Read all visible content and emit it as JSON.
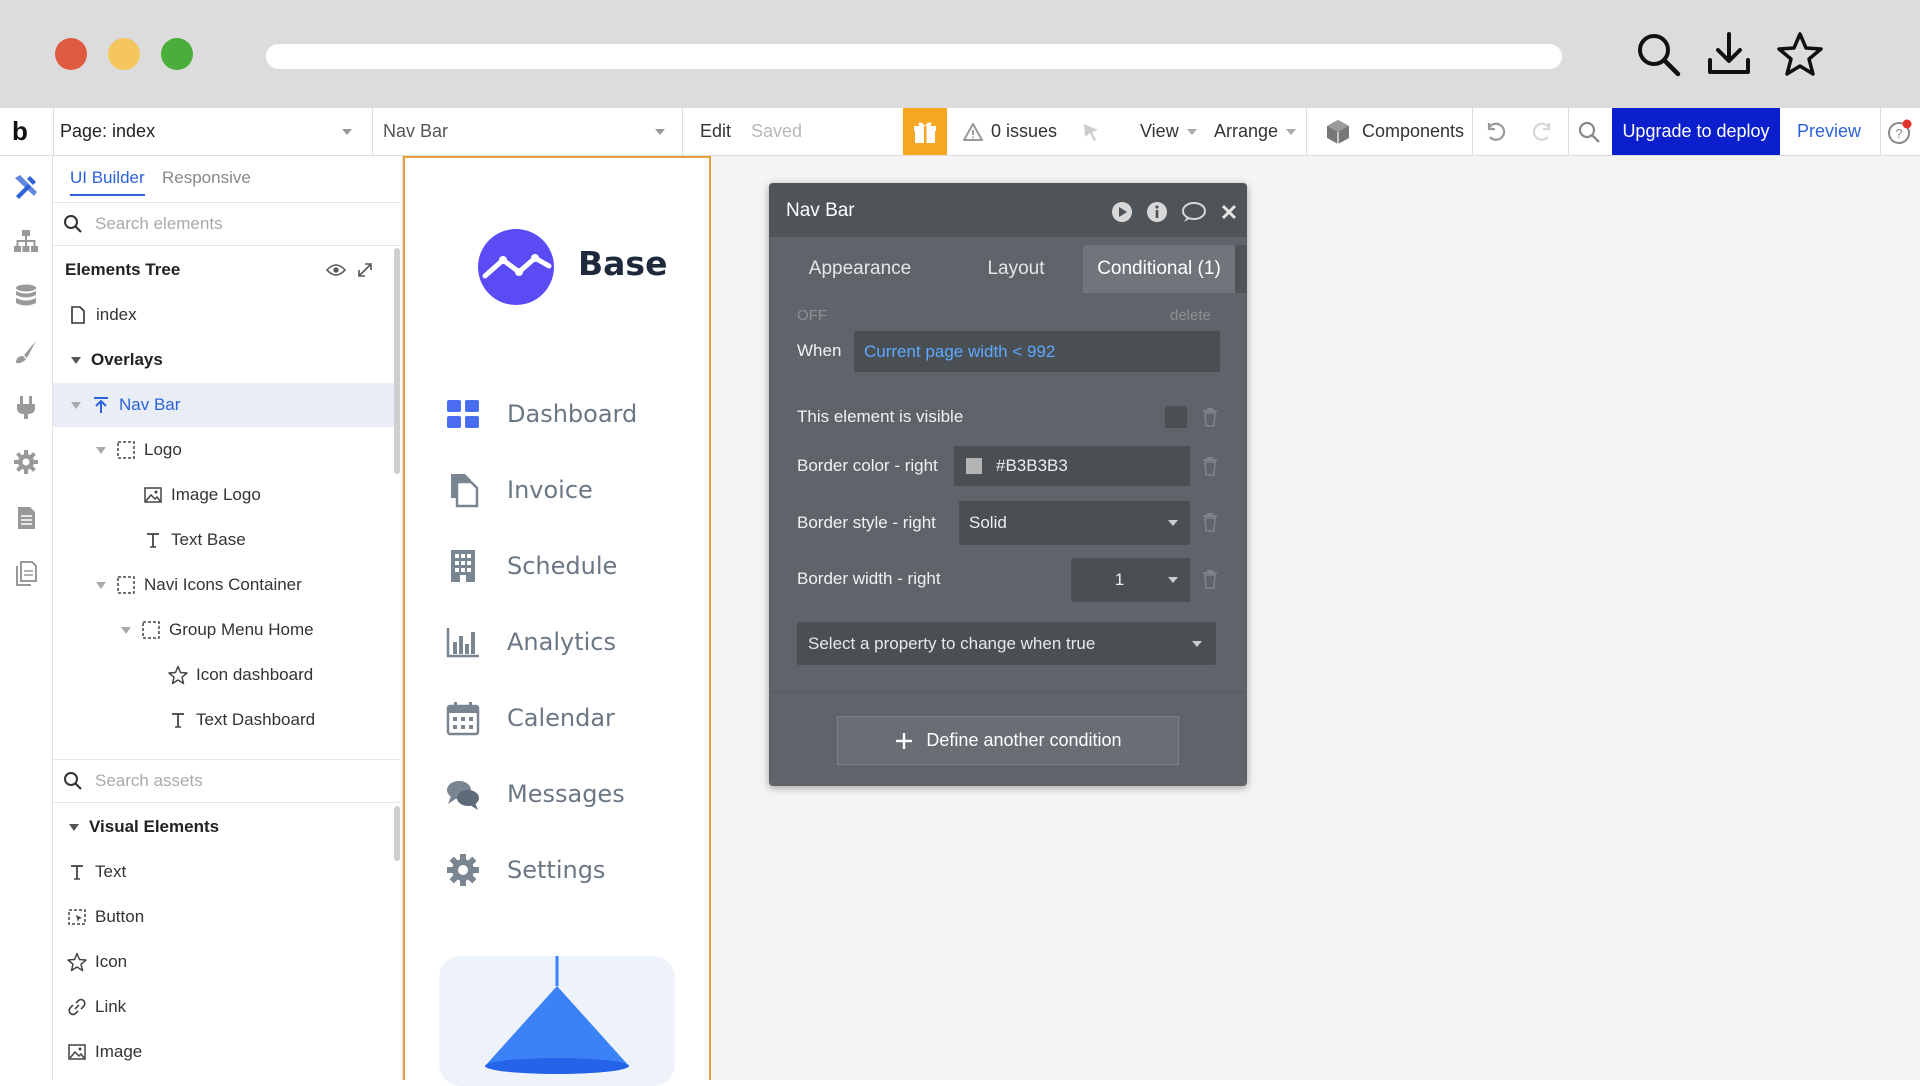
{
  "topbar": {
    "logo": "b",
    "page_select": "Page: index",
    "element_select": "Nav Bar",
    "edit": "Edit",
    "saved": "Saved",
    "issues": "0 issues",
    "view": "View",
    "arrange": "Arrange",
    "components": "Components",
    "upgrade": "Upgrade to deploy",
    "preview": "Preview"
  },
  "panel": {
    "tabs": [
      "UI Builder",
      "Responsive"
    ],
    "search_elements_placeholder": "Search elements",
    "tree_title": "Elements Tree",
    "tree": [
      {
        "label": "index",
        "icon": "page-icon"
      },
      {
        "label": "Overlays",
        "icon": "triangle"
      },
      {
        "label": "Nav Bar",
        "icon": "floating-group-icon"
      },
      {
        "label": "Logo",
        "icon": "group-icon"
      },
      {
        "label": "Image Logo",
        "icon": "image-icon"
      },
      {
        "label": "Text Base",
        "icon": "text-icon"
      },
      {
        "label": "Navi Icons Container",
        "icon": "group-icon"
      },
      {
        "label": "Group Menu Home",
        "icon": "group-icon"
      },
      {
        "label": "Icon dashboard",
        "icon": "star-icon"
      },
      {
        "label": "Text Dashboard",
        "icon": "text-icon"
      }
    ],
    "search_assets_placeholder": "Search assets",
    "visual_elements_title": "Visual Elements",
    "visual_elements": [
      {
        "label": "Text",
        "icon": "text-icon"
      },
      {
        "label": "Button",
        "icon": "button-icon"
      },
      {
        "label": "Icon",
        "icon": "star-icon"
      },
      {
        "label": "Link",
        "icon": "link-icon"
      },
      {
        "label": "Image",
        "icon": "image-icon"
      }
    ]
  },
  "page": {
    "brand": "Base",
    "nav": [
      "Dashboard",
      "Invoice",
      "Schedule",
      "Analytics",
      "Calendar",
      "Messages",
      "Settings"
    ]
  },
  "modal": {
    "title": "Nav Bar",
    "tabs": [
      "Appearance",
      "Layout",
      "Conditional (1)"
    ],
    "off": "OFF",
    "delete": "delete",
    "when": "When",
    "condition": "Current page width < 992",
    "props": {
      "visible_label": "This element is visible",
      "border_color_label": "Border color - right",
      "border_color_value": "#B3B3B3",
      "border_style_label": "Border style - right",
      "border_style_value": "Solid",
      "border_width_label": "Border width - right",
      "border_width_value": "1"
    },
    "select_property": "Select a property to change when true",
    "define_another": "Define another condition"
  },
  "colors": {
    "accent_blue": "#2d62d8",
    "upgrade_bg": "#0b20cc",
    "gift_bg": "#f5a623",
    "brand_purple": "#5b4bf5",
    "selection_bg": "#e8edf6",
    "border_color_swatch": "#B3B3B3"
  }
}
